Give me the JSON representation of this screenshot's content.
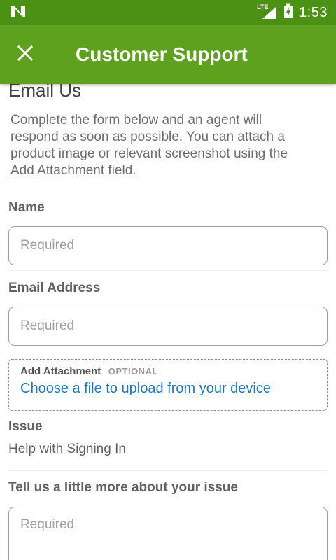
{
  "status_bar": {
    "network_label": "LTE",
    "time": "1:53",
    "background_color": "#4a9114",
    "icons": [
      "n-logo-icon",
      "signal-icon",
      "battery-charging-icon"
    ]
  },
  "app_bar": {
    "title": "Customer Support",
    "close_icon": "close-icon",
    "background_color": "#5da11e"
  },
  "form": {
    "heading": "Email Us",
    "intro": "Complete the form below and an agent will respond as soon as possible. You can attach a product image or relevant screenshot using the Add Attachment field.",
    "name": {
      "label": "Name",
      "placeholder": "Required",
      "value": ""
    },
    "email": {
      "label": "Email Address",
      "placeholder": "Required",
      "value": ""
    },
    "attachment": {
      "label": "Add Attachment",
      "optional_tag": "OPTIONAL",
      "link_text": "Choose a file to upload from your device",
      "link_color": "#1a78c2"
    },
    "issue": {
      "label": "Issue",
      "value": "Help with Signing In"
    },
    "details": {
      "label": "Tell us a little more about your issue",
      "placeholder": "Required",
      "value": ""
    }
  }
}
